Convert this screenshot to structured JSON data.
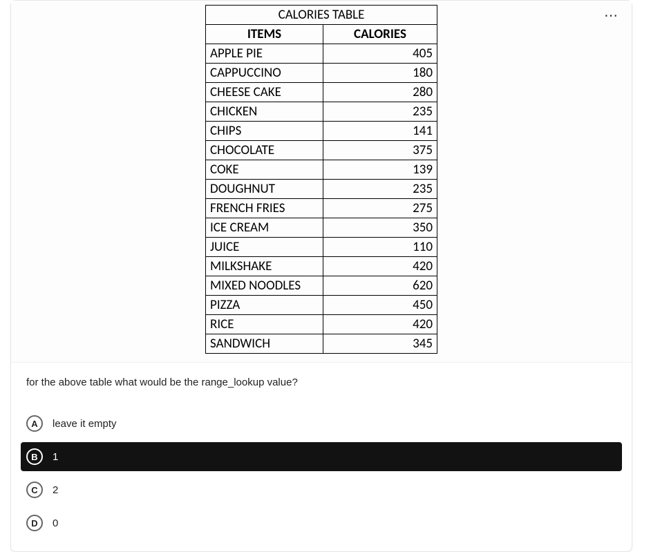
{
  "more_label": "⋯",
  "table": {
    "title": "CALORIES TABLE",
    "col1": "ITEMS",
    "col2": "CALORIES",
    "rows": [
      {
        "item": "APPLE PIE",
        "cal": "405"
      },
      {
        "item": "CAPPUCCINO",
        "cal": "180"
      },
      {
        "item": "CHEESE CAKE",
        "cal": "280"
      },
      {
        "item": "CHICKEN",
        "cal": "235"
      },
      {
        "item": "CHIPS",
        "cal": "141"
      },
      {
        "item": "CHOCOLATE",
        "cal": "375"
      },
      {
        "item": "COKE",
        "cal": "139"
      },
      {
        "item": "DOUGHNUT",
        "cal": "235"
      },
      {
        "item": "FRENCH FRIES",
        "cal": "275"
      },
      {
        "item": "ICE CREAM",
        "cal": "350"
      },
      {
        "item": "JUICE",
        "cal": "110"
      },
      {
        "item": "MILKSHAKE",
        "cal": "420"
      },
      {
        "item": "MIXED NOODLES",
        "cal": "620"
      },
      {
        "item": "PIZZA",
        "cal": "450"
      },
      {
        "item": "RICE",
        "cal": "420"
      },
      {
        "item": "SANDWICH",
        "cal": "345"
      }
    ]
  },
  "question": "for the above table what would be the range_lookup value?",
  "options": [
    {
      "letter": "A",
      "label": "leave it empty",
      "selected": false
    },
    {
      "letter": "B",
      "label": "1",
      "selected": true
    },
    {
      "letter": "C",
      "label": "2",
      "selected": false
    },
    {
      "letter": "D",
      "label": "0",
      "selected": false
    }
  ]
}
